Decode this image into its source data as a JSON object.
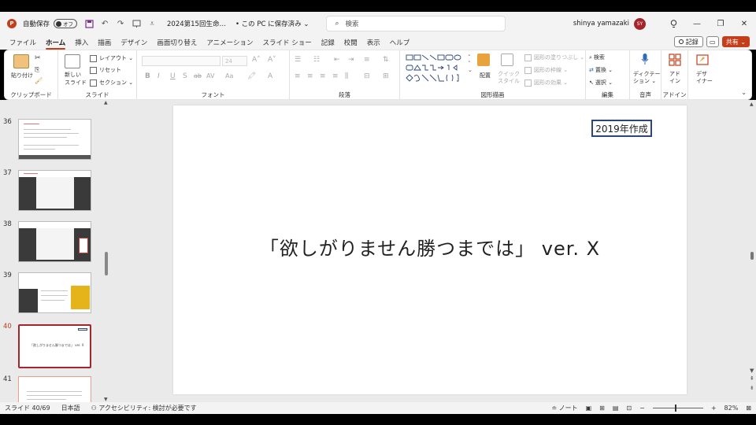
{
  "titlebar": {
    "app_logo": "P",
    "autosave_label": "自動保存",
    "autosave_state": "オフ",
    "doc_title": "2024第15回生命…",
    "save_state": "• この PC に保存済み ⌄",
    "search_placeholder": "検索",
    "username": "shinya yamazaki",
    "avatar_initials": "SY",
    "icons": [
      "save-icon",
      "undo-icon",
      "redo-icon",
      "present-icon",
      "customize-icon",
      "lightbulb-icon",
      "minimize-icon",
      "restore-icon",
      "close-icon"
    ]
  },
  "tabs": [
    "ファイル",
    "ホーム",
    "挿入",
    "描画",
    "デザイン",
    "画面切り替え",
    "アニメーション",
    "スライド ショー",
    "記録",
    "校閲",
    "表示",
    "ヘルプ"
  ],
  "active_tab": "ホーム",
  "tab_buttons": {
    "record": "記録",
    "share": "共有 ⌄"
  },
  "ribbon": {
    "clipboard": {
      "paste": "貼り付け",
      "label": "クリップボード"
    },
    "slides": {
      "new_slide": "新しい\nスライド",
      "layout": "レイアウト ⌄",
      "reset": "リセット",
      "section": "セクション ⌄",
      "label": "スライド"
    },
    "font": {
      "size": "24",
      "label": "フォント",
      "buttons": [
        "B",
        "I",
        "U",
        "S",
        "ab",
        "AV",
        "Aa"
      ]
    },
    "paragraph": {
      "label": "段落"
    },
    "drawing": {
      "arrange": "配置",
      "quick_styles": "クイック\nスタイル",
      "fill": "図形の塗りつぶし ⌄",
      "outline": "図形の枠線 ⌄",
      "effects": "図形の効果 ⌄",
      "label": "図形描画"
    },
    "editing": {
      "find": "検索",
      "replace": "置換 ⌄",
      "select": "選択 ⌄",
      "label": "編集"
    },
    "voice": {
      "dictate": "ディクテー\nション ⌄",
      "label": "音声"
    },
    "addins": {
      "addins": "アド\nイン",
      "label": "アドイン"
    },
    "designer": {
      "designer": "デザ\nイナー"
    }
  },
  "thumbnails": [
    {
      "num": "36"
    },
    {
      "num": "37"
    },
    {
      "num": "38"
    },
    {
      "num": "39"
    },
    {
      "num": "40",
      "active": true,
      "text": "「欲しがりません勝つまでは」 ver. X"
    },
    {
      "num": "41"
    }
  ],
  "slide": {
    "label_box": "2019年作成",
    "title": "「欲しがりません勝つまでは」 ver. X"
  },
  "statusbar": {
    "slide_position": "スライド 40/69",
    "language": "日本語",
    "accessibility": "アクセシビリティ: 検討が必要です",
    "notes": "ノート",
    "zoom": "82%"
  },
  "colors": {
    "accent": "#c43e1c",
    "avatar": "#a4262c",
    "label_border": "#2e4577"
  }
}
